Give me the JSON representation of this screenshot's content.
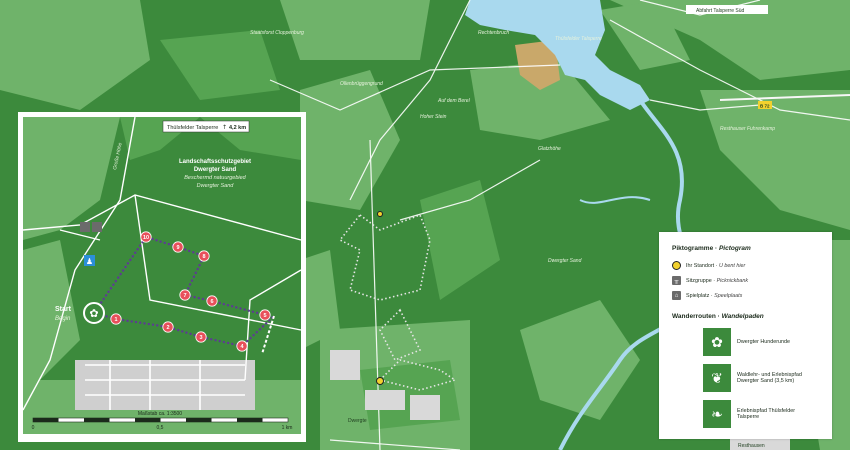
{
  "inset": {
    "direction_sign": "Thülsfelder Talsperre",
    "direction_distance": "4,2 km",
    "area_title_1": "Landschaftsschutzgebiet",
    "area_title_2": "Dwergter Sand",
    "area_sub_1": "Beschermd natuurgebied",
    "area_sub_2": "Dwergter Sand",
    "road_label": "Große Höhe",
    "start_label": "Start",
    "start_sub": "Begin",
    "scale_label": "Maßstab ca. 1:3500",
    "scale_ticks": [
      "0",
      "0,5",
      "1 km"
    ],
    "waypoints": [
      "1",
      "2",
      "3",
      "4",
      "5",
      "6",
      "7",
      "8",
      "9",
      "10"
    ]
  },
  "map_labels": {
    "forest_1": "Staatsforst Cloppenburg",
    "forest_2": "Ollenbrüggengrund",
    "area_1": "Auf dem Berel",
    "hill_1": "Hoher Stein",
    "hill_2": "Glatzhöhe",
    "lake_area": "Rechtenbruch",
    "talsperre": "Thülsfelder Talsperre",
    "exit_sign": "Abfahrt Talsperre Süd",
    "b72": "B 72",
    "forest_3": "Resthauser Fuhrenkamp",
    "sand": "Dwergter Sand",
    "town_1": "Dwergte",
    "town_2": "Resthausen"
  },
  "legend": {
    "pict_title": "Piktogramme",
    "pict_title_nl": "Pictogram",
    "items": [
      {
        "label": "Ihr Standort",
        "nl": "U bent hier",
        "icon": "you-are-here-icon"
      },
      {
        "label": "Sitzgruppe",
        "nl": "Picknickbank",
        "icon": "picnic-table-icon"
      },
      {
        "label": "Spielplatz",
        "nl": "Speelplaats",
        "icon": "playground-icon"
      }
    ],
    "routes_title": "Wanderrouten",
    "routes_title_nl": "Wandelpaden",
    "routes": [
      {
        "label_1": "Dwergter Hunderunde",
        "label_2": "",
        "icon": "paw-icon"
      },
      {
        "label_1": "Waldlehr- und Erlebnispfad",
        "label_2": "Dwergter Sand (3,5 km)",
        "icon": "maple-leaf-icon"
      },
      {
        "label_1": "Erlebnispfad Thülsfelder",
        "label_2": "Talsperre",
        "icon": "bird-icon"
      }
    ]
  },
  "colors": {
    "forest": "#3c8a3c",
    "open_land": "#6fb36a",
    "water": "#a9d9ee",
    "route": "#5b3f8f",
    "waypoint": "#e8505b",
    "sand": "#c9a86a"
  }
}
